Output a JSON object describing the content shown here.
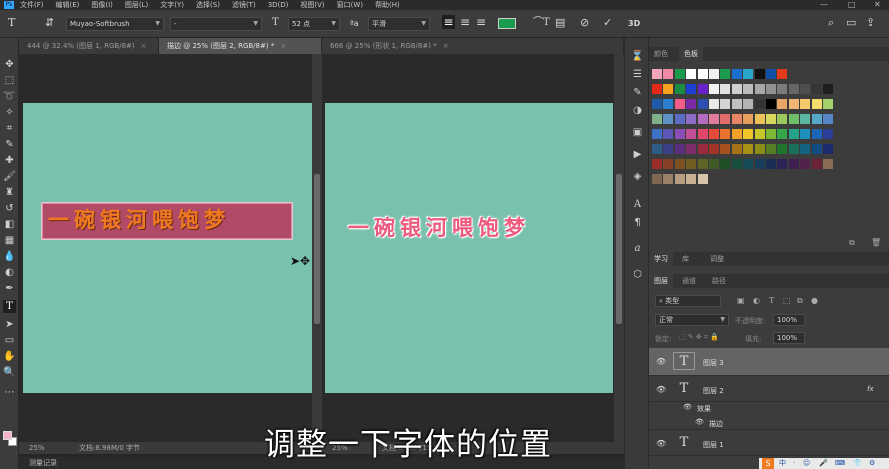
{
  "menu": {
    "items": [
      "文件(F)",
      "编辑(E)",
      "图像(I)",
      "图层(L)",
      "文字(Y)",
      "选择(S)",
      "滤镜(T)",
      "3D(D)",
      "视图(V)",
      "窗口(W)",
      "帮助(H)"
    ],
    "minimize": "—",
    "restore": "□",
    "close": "✕"
  },
  "options": {
    "font_family": "Muyao-Softbrush",
    "font_style": "-",
    "font_size": "52 点",
    "antialias": "平滑",
    "color_swatch": "#1a9b4e"
  },
  "tabs": [
    {
      "label": "444 @ 32.4% (图层 1, RGB/8#)",
      "close": "×"
    },
    {
      "label": "描边 @ 25% (图层 2, RGB/8#) *",
      "close": "×"
    },
    {
      "label": "666 @ 25% (形状 1, RGB/8#) *",
      "close": "×"
    }
  ],
  "canvas": {
    "left_text": "一碗银河喂饱梦",
    "right_text": "一碗银河喂饱梦",
    "artboard_color": "#79c0ad",
    "left_text_color": "#f07a20",
    "left_text_bg": "#b14a66",
    "right_text_color": "#ec5a7e"
  },
  "status": {
    "zoom_left": "25%",
    "doc_left": "文档:8.98M/0 字节",
    "zoom_right": "25%",
    "doc_right": "文档:8.98M/15.8M",
    "bottom_tab": "测量记录"
  },
  "subtitle": "调整一下字体的位置",
  "swatch_panel": {
    "tabs": [
      "颜色",
      "色板"
    ],
    "rows": [
      [
        "#f4a5b9",
        "#f08aa7",
        "#1a9b4e",
        "#ffffff",
        "#ffffff",
        "#f0f0f0",
        "#1a9b4e",
        "#1a6fd0",
        "#2aa7c8",
        "#111111",
        "#0f4fa5",
        "#e33b1a"
      ],
      [
        "#e32a1a",
        "#f5a11d",
        "#1c8b44",
        "#1e3fd2",
        "#6a22c8",
        "#f2f2f2",
        "#e0e0e0",
        "#cfcfcf",
        "#bcbcbc",
        "#a8a8a8",
        "#929292",
        "#7c7c7c",
        "#666666",
        "#4e4e4e",
        "#363636",
        "#1e1e1e"
      ],
      [
        "#1e5aa8",
        "#2a7fd1",
        "#f25c8a",
        "#7a2aa5",
        "#2d4fb0",
        "#e8e8e8",
        "#d4d4d4",
        "#c0c0c0",
        "#b4b4b4",
        "#333333",
        "#000000",
        "#e8a565",
        "#f1b778",
        "#f5cb6e",
        "#f4dc6c",
        "#a3d26d"
      ],
      [
        "#7fb08a",
        "#5f93c8",
        "#5b6cc2",
        "#8c6cc4",
        "#b46cc0",
        "#e07c9c",
        "#e26d6b",
        "#e88564",
        "#e9a05c",
        "#ebc25a",
        "#d6d65c",
        "#9ac85c",
        "#6fbf6a",
        "#5bb7a4",
        "#57a7c8",
        "#5685c8"
      ],
      [
        "#3f70c8",
        "#5c58b8",
        "#8a4fb4",
        "#c04f98",
        "#e2476a",
        "#e24a3a",
        "#e8722e",
        "#efa12a",
        "#f0c72a",
        "#c6c72c",
        "#7cb833",
        "#32a84a",
        "#25a38a",
        "#1f8fbd",
        "#1b64b8",
        "#2c3e98"
      ],
      [
        "#2d5c86",
        "#3a3f86",
        "#5a2f7e",
        "#7e2c6a",
        "#9c2a3e",
        "#a23427",
        "#a5521e",
        "#a87318",
        "#a89017",
        "#8a8d18",
        "#557f22",
        "#20752f",
        "#1a6f5d",
        "#146380",
        "#124a82",
        "#1d2b6e"
      ],
      [
        "#9b2d2a",
        "#874023",
        "#7d5222",
        "#6f5d22",
        "#5d6424",
        "#405b25",
        "#1e4f27",
        "#17503f",
        "#164b57",
        "#163d5c",
        "#1a2d56",
        "#2a2355",
        "#3e1f52",
        "#54214b",
        "#6b2236",
        "#8a6d56"
      ],
      [
        "#7e6650",
        "#9a8068",
        "#b69c80",
        "#c8b092",
        "#d8c4a8"
      ]
    ]
  },
  "panel_mid": {
    "tabs": [
      "学习",
      "库",
      "调整"
    ]
  },
  "layers_panel": {
    "tabs": [
      "图层",
      "通道",
      "路径"
    ],
    "filter_label": "类型",
    "blend_mode": "正常",
    "opacity_label": "不透明度:",
    "opacity_value": "100%",
    "lock_label": "锁定:",
    "fill_label": "填充:",
    "fill_value": "100%",
    "layers": [
      {
        "name": "图层 3",
        "selected": true
      },
      {
        "name": "图层 2",
        "fx": "fx"
      },
      {
        "name": "效果"
      },
      {
        "name": "描边"
      },
      {
        "name": "图层 1"
      }
    ]
  },
  "taskbar": {
    "logo": "S",
    "items": [
      "中",
      "·",
      "☺",
      "🎤",
      "⌨",
      "👕",
      "⚙"
    ]
  }
}
